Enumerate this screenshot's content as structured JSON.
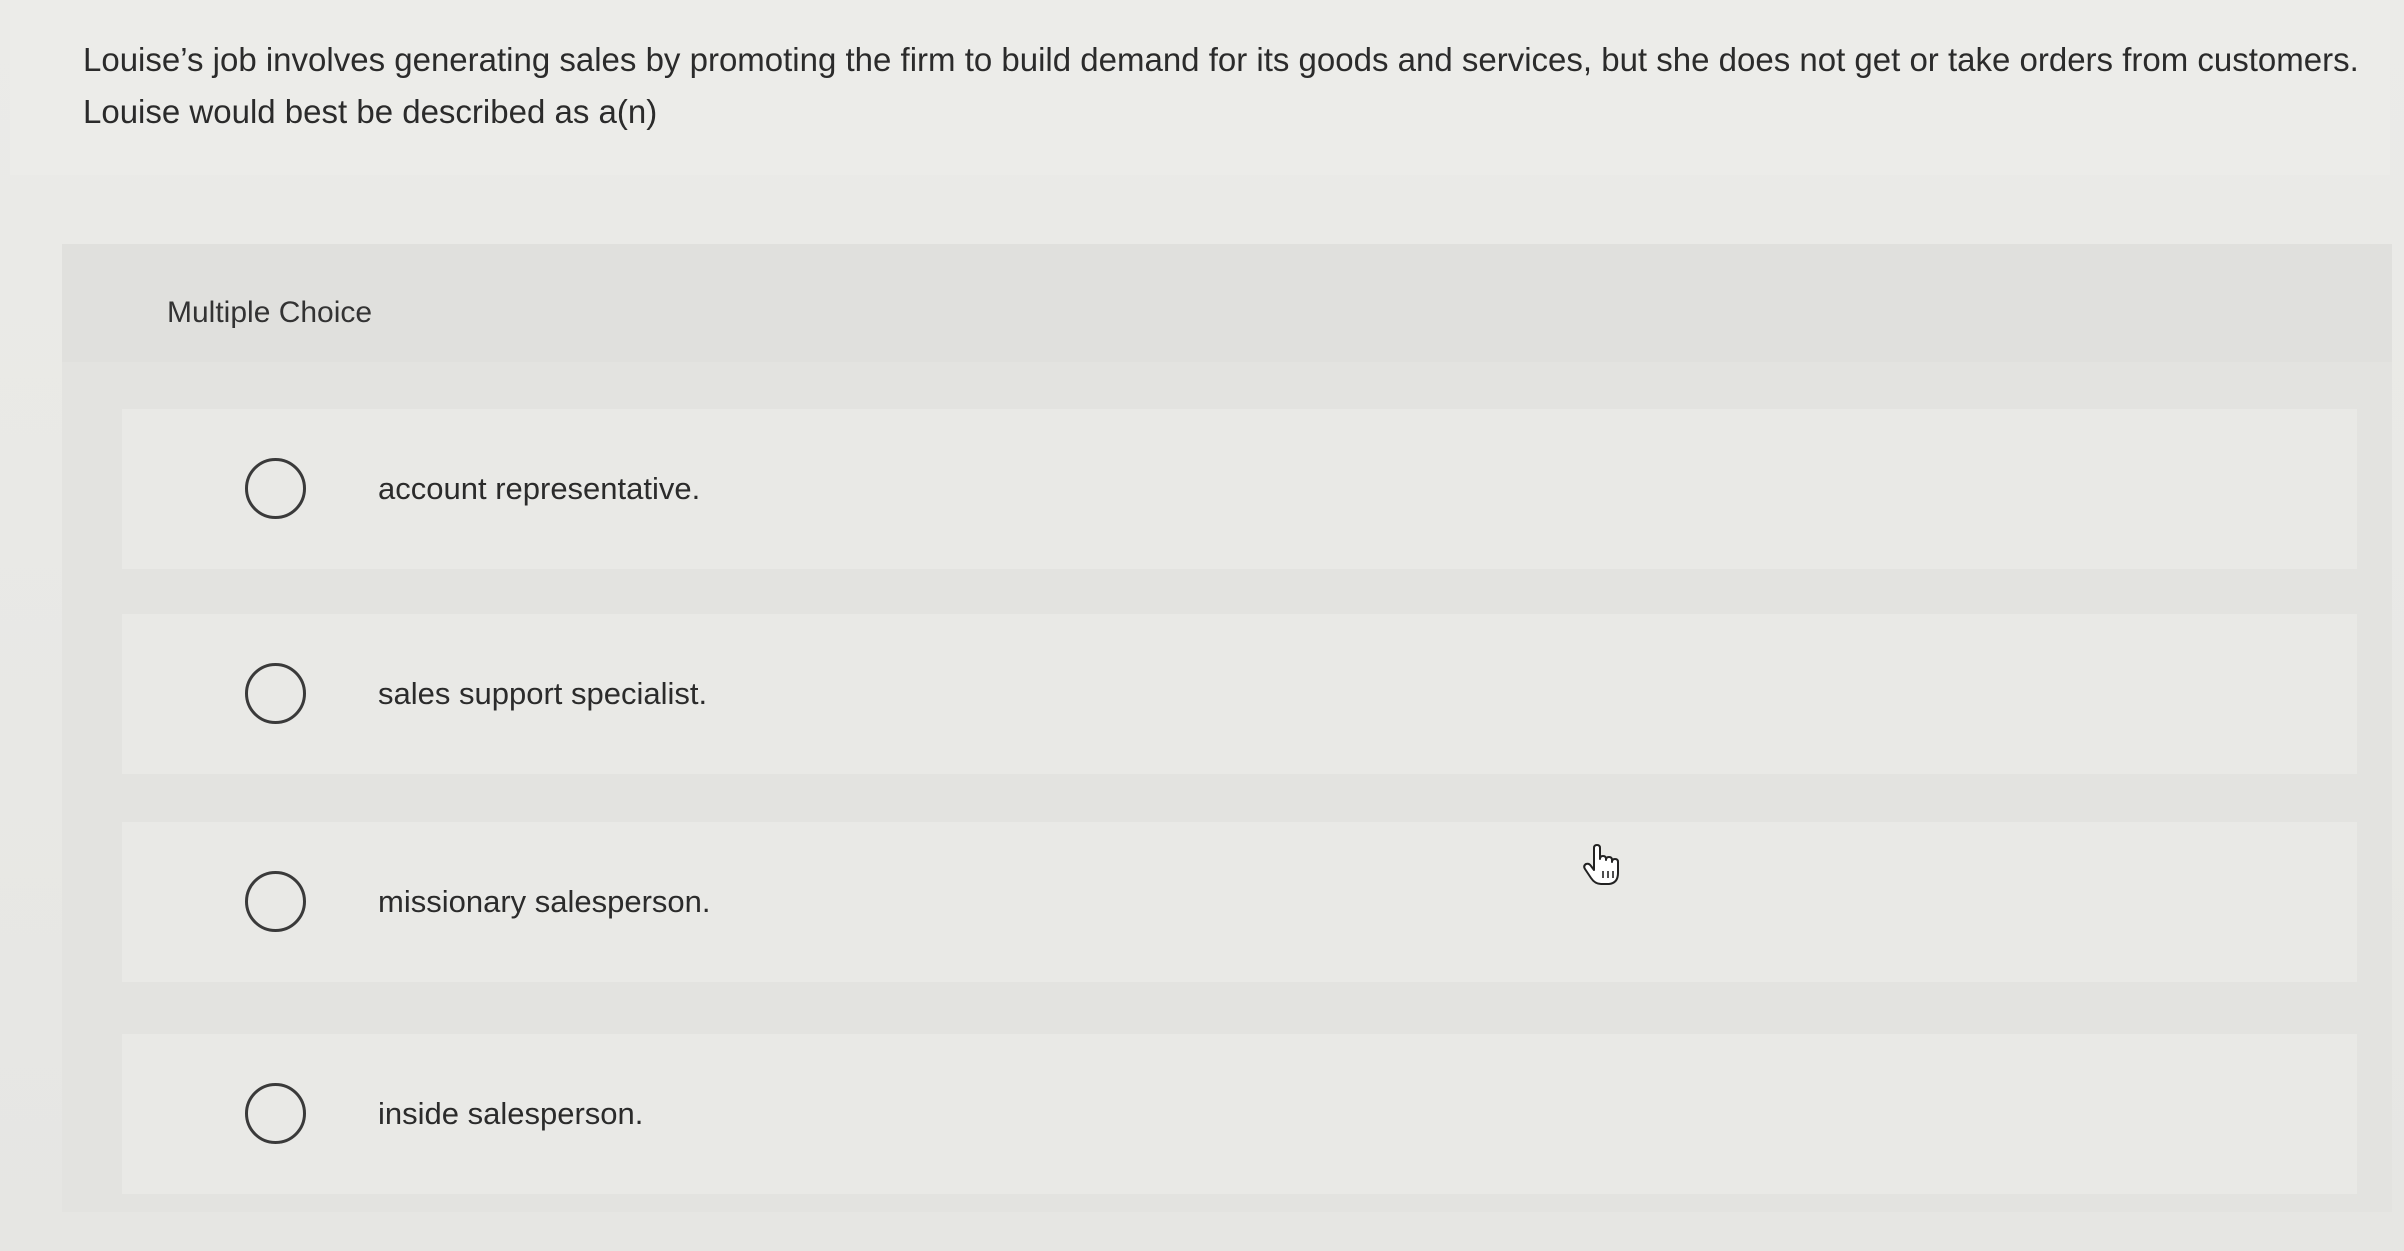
{
  "question": {
    "text": "Louise’s job involves generating sales by promoting the firm to build demand for its goods and services, but she does not get or take orders from customers. Louise would best be described as a(n)"
  },
  "multiple_choice": {
    "label": "Multiple Choice",
    "options": [
      {
        "label": "account representative."
      },
      {
        "label": "sales support specialist."
      },
      {
        "label": "missionary salesperson."
      },
      {
        "label": "inside salesperson."
      }
    ]
  },
  "cursor": {
    "icon": "hand-pointer-icon"
  }
}
